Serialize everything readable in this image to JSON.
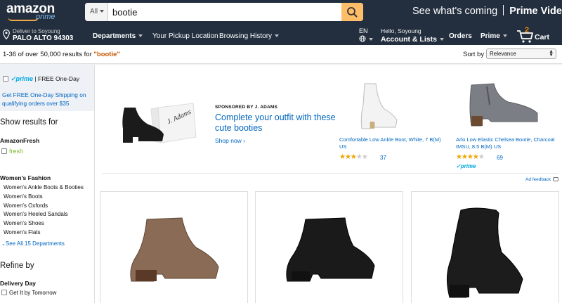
{
  "header": {
    "logo_text": "amazon",
    "logo_sub": "prime",
    "search_category": "All",
    "search_value": "bootie",
    "promo_text": "See what's coming",
    "promo_brand": "Prime Video"
  },
  "nav": {
    "deliver_line1": "Deliver to Soyoung",
    "deliver_line2": "PALO ALTO 94303",
    "departments": "Departments",
    "pickup": "Your Pickup Location",
    "history": "Browsing History",
    "lang": "EN",
    "hello": "Hello, Soyoung",
    "account": "Account & Lists",
    "orders": "Orders",
    "prime": "Prime",
    "cart_count": "2",
    "cart": "Cart"
  },
  "results": {
    "count_text": "1-36 of over 50,000 results for ",
    "query": "\"bootie\"",
    "sort_label": "Sort by",
    "sort_value": "Relevance"
  },
  "sidebar": {
    "prime_check": "✓prime",
    "prime_label": "| FREE One-Day",
    "prime_desc": "Get FREE One-Day Shipping on qualifying orders over $35",
    "show_results": "Show results for",
    "amazonfresh": "AmazonFresh",
    "fresh": "fresh",
    "womens_fashion": "Women's Fashion",
    "categories": [
      "Women's Ankle Boots & Booties",
      "Women's Boots",
      "Women's Oxfords",
      "Women's Heeled Sandals",
      "Women's Shoes",
      "Women's Flats"
    ],
    "see_all": "See All 15 Departments",
    "refine": "Refine by",
    "delivery_day": "Delivery Day",
    "tomorrow": "Get It by Tomorrow"
  },
  "banner": {
    "sponsored": "SPONSORED BY J. ADAMS",
    "headline": "Complete your outfit with these cute booties",
    "shop_now": "Shop now ›",
    "box_brand": "J. Adams",
    "products": [
      {
        "title": "Comfortable Low Ankle Boot, White, 7 B(M) US",
        "rating": 3.5,
        "reviews": "37",
        "prime": ""
      },
      {
        "title": "Arlo Low Elastic Chelsea Bootie, Charcoal IMSU, 8.5 B(M) US",
        "rating": 4.5,
        "reviews": "69",
        "prime": "✓prime"
      }
    ],
    "ad_feedback": "Ad feedback"
  },
  "colors": {
    "nav_dark": "#232f3e",
    "search_orange": "#febd69",
    "link_blue": "#0066c0",
    "query_orange": "#c45500",
    "prime_blue": "#00a8e1",
    "star_gold": "#f0a500"
  }
}
